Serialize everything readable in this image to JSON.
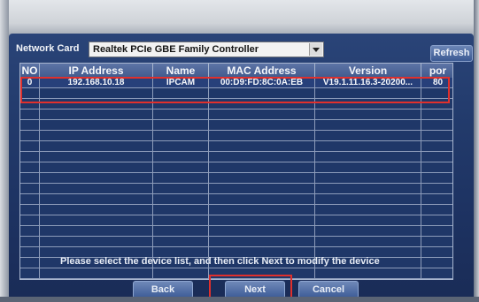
{
  "network_card": {
    "label": "Network Card",
    "selected": "Realtek PCIe GBE Family Controller"
  },
  "refresh_label": "Refresh",
  "table": {
    "columns": [
      "NO",
      "IP Address",
      "Name",
      "MAC Address",
      "Version",
      "por"
    ],
    "rows": [
      {
        "no": "0",
        "ip": "192.168.10.18",
        "name": "IPCAM",
        "mac": "00:D9:FD:8C:0A:EB",
        "version": "V19.1.11.16.3-20200...",
        "port": "80"
      }
    ]
  },
  "hint": "Please select the device list, and then click Next to modify the device",
  "buttons": {
    "back": "Back",
    "next": "Next",
    "cancel": "Cancel"
  },
  "colors": {
    "highlight": "#e0302c",
    "screen_bg": "#223a6b",
    "button_bg": "#3d5c97"
  }
}
